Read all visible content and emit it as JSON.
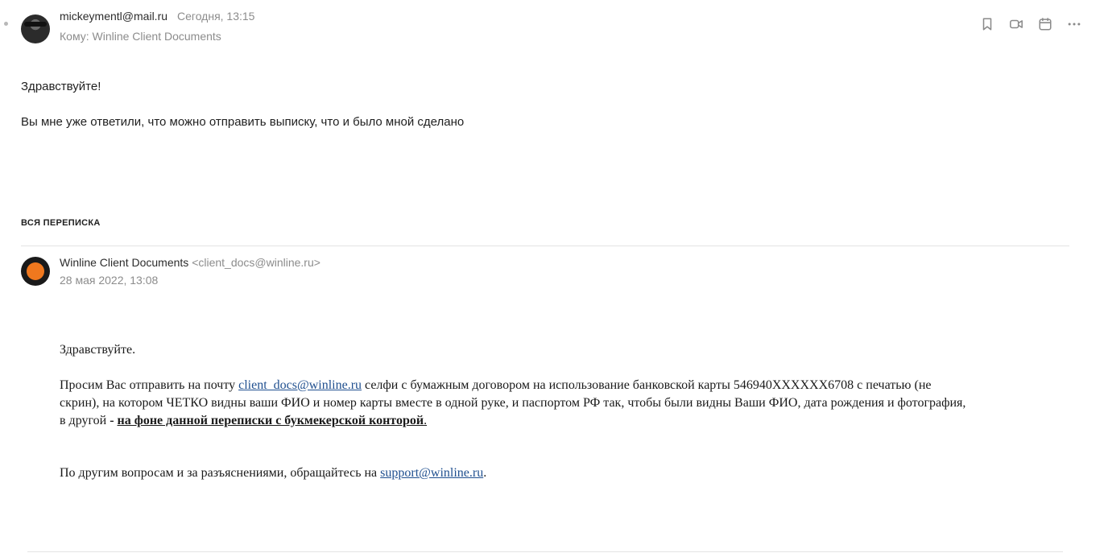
{
  "message": {
    "sender_email": "mickeymentl@mail.ru",
    "date": "Сегодня, 13:15",
    "to_label": "Кому:",
    "to_name": "Winline Client Documents",
    "greeting": "Здравствуйте!",
    "body": "Вы мне уже ответили, что можно отправить выписку, что и было мной сделано"
  },
  "toolbar": {
    "icons": [
      "bookmark-icon",
      "video-call-icon",
      "calendar-icon",
      "more-icon"
    ]
  },
  "thread": {
    "label": "ВСЯ ПЕРЕПИСКА",
    "sender_name": "Winline Client Documents",
    "sender_address": "<client_docs@winline.ru>",
    "date": "28 мая 2022, 13:08",
    "greeting": "Здравствуйте.",
    "para1_a": "Просим Вас отправить на почту ",
    "para1_link": "client_docs@winline.ru",
    "para1_b": " селфи с  бумажным договором на использование банковской карты 546940XXXXXX6708  с печатью (не",
    "para1_line2": "скрин), на котором ЧЕТКО видны ваши ФИО и номер карты    вместе в одной руке, и паспортом РФ так, чтобы были видны Ваши ФИО, дата рождения и фотография,",
    "para1_line3_a": "в другой ",
    "para1_line3_dash": "- ",
    "para1_line3_emph": "на фоне данной  переписки с букмекерской конторой",
    "para1_line3_end": ".",
    "para2_a": "По другим вопросам и за разъяснениями, обращайтесь на ",
    "para2_link": "support@winline.ru",
    "para2_end": "."
  }
}
